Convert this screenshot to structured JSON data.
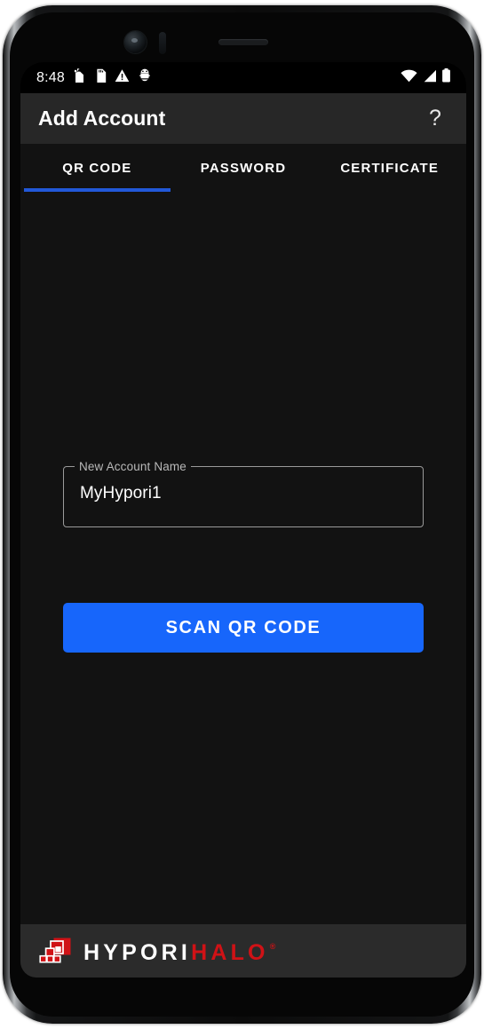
{
  "status_bar": {
    "clock": "8:48",
    "left_icons": [
      "sim-card-alert-icon",
      "sd-card-icon",
      "warning-triangle-icon",
      "adb-debug-icon"
    ],
    "right_icons": [
      "wifi-icon",
      "cellular-signal-icon",
      "battery-full-icon"
    ]
  },
  "app_bar": {
    "title": "Add Account",
    "help_icon": "question-mark-icon",
    "help_label": "?"
  },
  "tabs": [
    {
      "label": "QR CODE",
      "active": true
    },
    {
      "label": "PASSWORD",
      "active": false
    },
    {
      "label": "CERTIFICATE",
      "active": false
    }
  ],
  "form": {
    "account_name_label": "New Account Name",
    "account_name_value": "MyHypori1",
    "account_name_placeholder": "New Account Name"
  },
  "actions": {
    "scan_button_label": "SCAN QR CODE"
  },
  "footer": {
    "logo_icon": "hypori-squares-logo-icon",
    "brand_primary": "HYPORI",
    "brand_secondary": "HALO",
    "registered_mark": "®"
  },
  "colors": {
    "accent_blue": "#1766fb",
    "tab_indicator_blue": "#2258d8",
    "brand_red": "#d01216",
    "screen_background": "#121212",
    "app_bar_background": "#272727",
    "footer_background": "#2b2b2b"
  }
}
